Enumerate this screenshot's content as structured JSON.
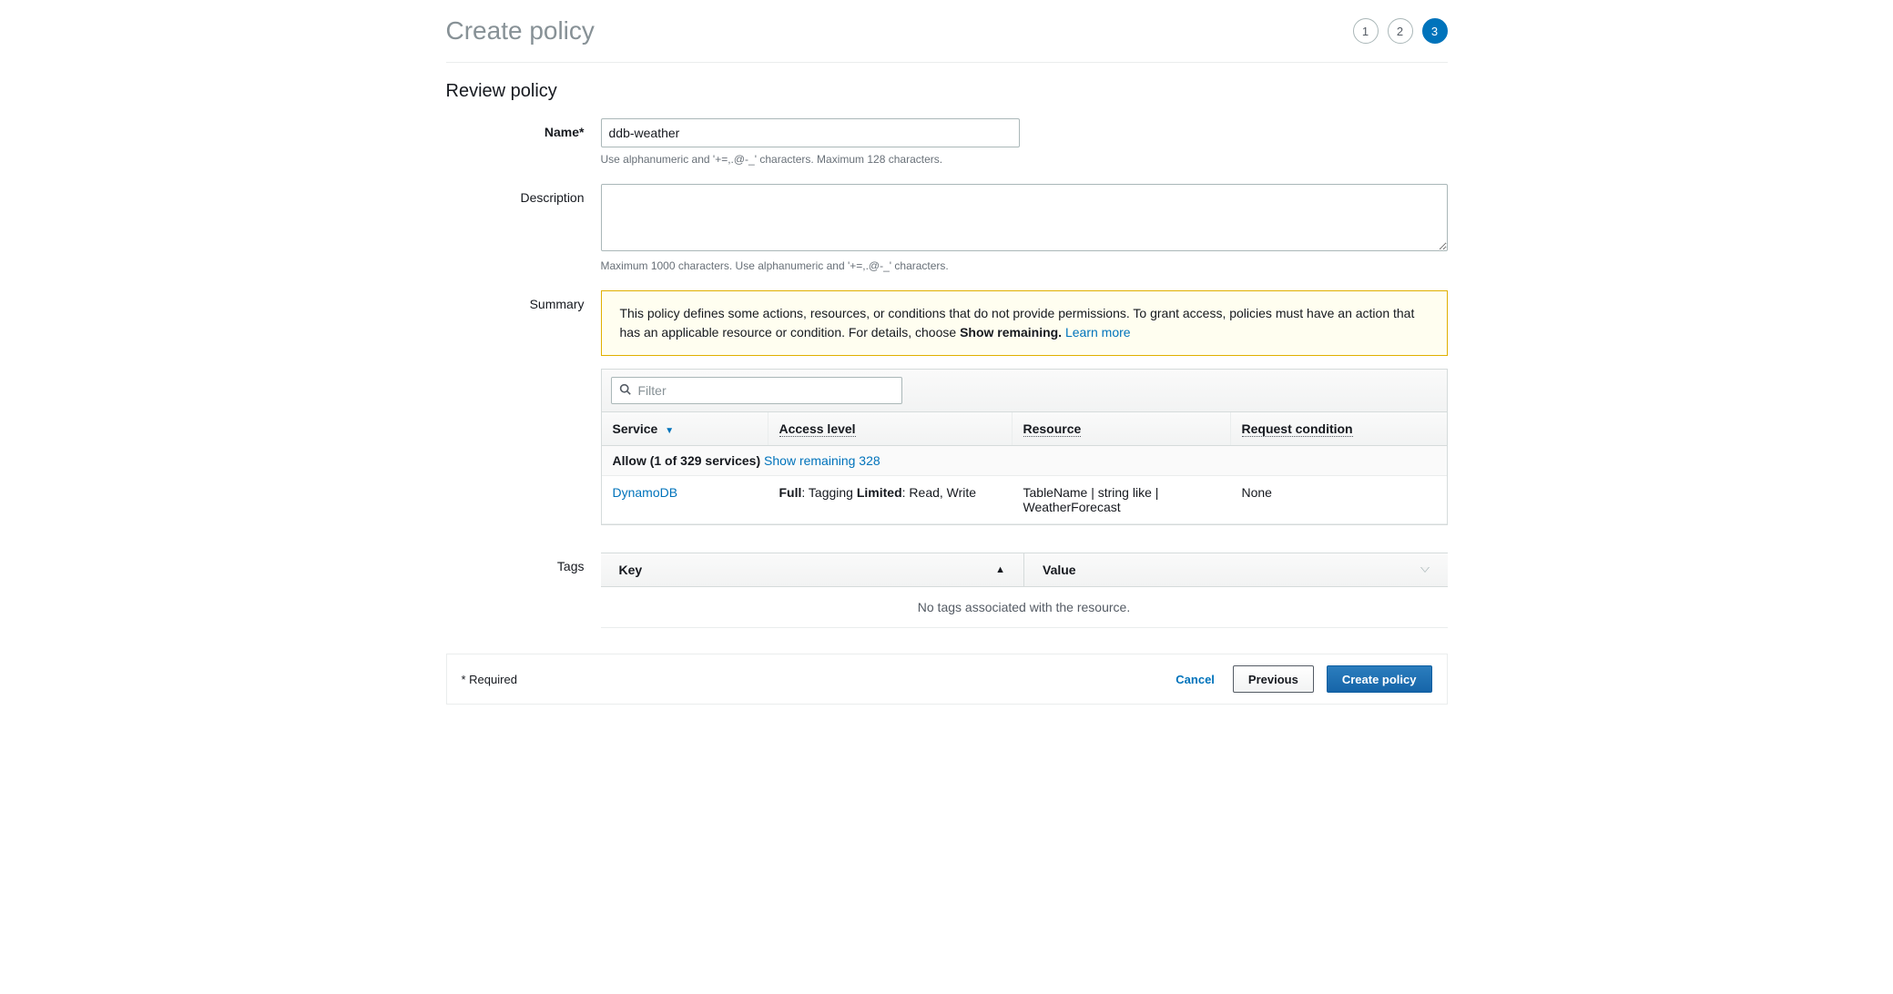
{
  "header": {
    "title": "Create policy",
    "steps": [
      "1",
      "2",
      "3"
    ],
    "active_step_index": 2
  },
  "review": {
    "title": "Review policy",
    "name_label": "Name*",
    "name_value": "ddb-weather",
    "name_hint": "Use alphanumeric and '+=,.@-_' characters. Maximum 128 characters.",
    "description_label": "Description",
    "description_value": "",
    "description_hint": "Maximum 1000 characters. Use alphanumeric and '+=,.@-_' characters.",
    "summary_label": "Summary",
    "warning_text_1": "This policy defines some actions, resources, or conditions that do not provide permissions. To grant access, policies must have an action that has an applicable resource or condition. For details, choose ",
    "warning_bold": "Show remaining.",
    "warning_learn_more": "Learn more",
    "filter_placeholder": "Filter",
    "columns": {
      "service": "Service",
      "access": "Access level",
      "resource": "Resource",
      "request": "Request condition"
    },
    "allow_text": "Allow (1 of 329 services)",
    "show_remaining": "Show remaining 328",
    "row": {
      "service": "DynamoDB",
      "access_full_label": "Full",
      "access_full_value": ": Tagging ",
      "access_limited_label": "Limited",
      "access_limited_value": ": Read, Write",
      "resource": "TableName | string like | WeatherForecast",
      "request": "None"
    }
  },
  "tags": {
    "label": "Tags",
    "key_header": "Key",
    "value_header": "Value",
    "empty": "No tags associated with the resource."
  },
  "footer": {
    "required": "* Required",
    "cancel": "Cancel",
    "previous": "Previous",
    "create": "Create policy"
  }
}
